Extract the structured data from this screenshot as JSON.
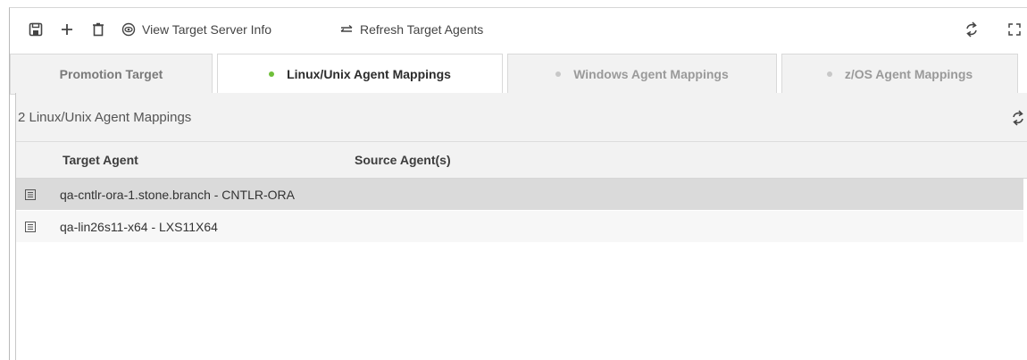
{
  "toolbar": {
    "view_target_server_info": "View Target Server Info",
    "refresh_target_agents": "Refresh Target Agents"
  },
  "tabs": [
    {
      "label": "Promotion Target",
      "active": false,
      "dot": false
    },
    {
      "label": "Linux/Unix Agent Mappings",
      "active": true,
      "dot": true,
      "dot_color": "#6fbf3a"
    },
    {
      "label": "Windows Agent Mappings",
      "active": false,
      "dot": true,
      "dot_color": "#c8c8c8"
    },
    {
      "label": "z/OS Agent Mappings",
      "active": false,
      "dot": true,
      "dot_color": "#c8c8c8"
    }
  ],
  "panel": {
    "title": "2 Linux/Unix Agent Mappings"
  },
  "table": {
    "columns": [
      "Target Agent",
      "Source Agent(s)"
    ],
    "rows": [
      {
        "target": "qa-cntlr-ora-1.stone.branch - CNTLR-ORA",
        "source": "",
        "selected": true
      },
      {
        "target": "qa-lin26s11-x64 - LXS11X64",
        "source": "",
        "selected": false
      }
    ]
  },
  "colors": {
    "accent": "#4d8fd8",
    "active_dot": "#6fbf3a",
    "inactive_dot": "#c8c8c8"
  }
}
